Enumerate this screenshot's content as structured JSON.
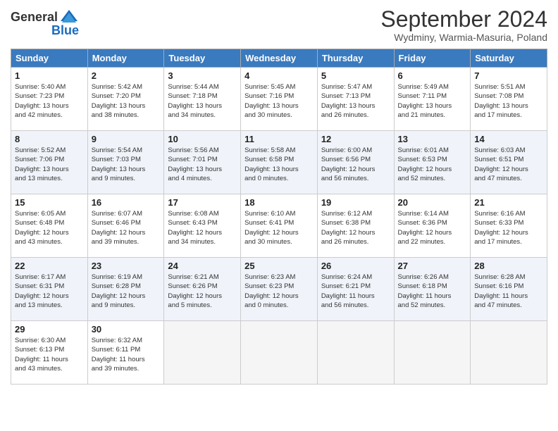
{
  "header": {
    "logo_general": "General",
    "logo_blue": "Blue",
    "month_title": "September 2024",
    "location": "Wydminy, Warmia-Masuria, Poland"
  },
  "days_of_week": [
    "Sunday",
    "Monday",
    "Tuesday",
    "Wednesday",
    "Thursday",
    "Friday",
    "Saturday"
  ],
  "weeks": [
    {
      "alt": false,
      "days": [
        {
          "num": "",
          "detail": ""
        },
        {
          "num": "2",
          "detail": "Sunrise: 5:42 AM\nSunset: 7:20 PM\nDaylight: 13 hours\nand 38 minutes."
        },
        {
          "num": "3",
          "detail": "Sunrise: 5:44 AM\nSunset: 7:18 PM\nDaylight: 13 hours\nand 34 minutes."
        },
        {
          "num": "4",
          "detail": "Sunrise: 5:45 AM\nSunset: 7:16 PM\nDaylight: 13 hours\nand 30 minutes."
        },
        {
          "num": "5",
          "detail": "Sunrise: 5:47 AM\nSunset: 7:13 PM\nDaylight: 13 hours\nand 26 minutes."
        },
        {
          "num": "6",
          "detail": "Sunrise: 5:49 AM\nSunset: 7:11 PM\nDaylight: 13 hours\nand 21 minutes."
        },
        {
          "num": "7",
          "detail": "Sunrise: 5:51 AM\nSunset: 7:08 PM\nDaylight: 13 hours\nand 17 minutes."
        }
      ],
      "first": {
        "num": "1",
        "detail": "Sunrise: 5:40 AM\nSunset: 7:23 PM\nDaylight: 13 hours\nand 42 minutes."
      }
    },
    {
      "alt": true,
      "days": [
        {
          "num": "8",
          "detail": "Sunrise: 5:52 AM\nSunset: 7:06 PM\nDaylight: 13 hours\nand 13 minutes."
        },
        {
          "num": "9",
          "detail": "Sunrise: 5:54 AM\nSunset: 7:03 PM\nDaylight: 13 hours\nand 9 minutes."
        },
        {
          "num": "10",
          "detail": "Sunrise: 5:56 AM\nSunset: 7:01 PM\nDaylight: 13 hours\nand 4 minutes."
        },
        {
          "num": "11",
          "detail": "Sunrise: 5:58 AM\nSunset: 6:58 PM\nDaylight: 13 hours\nand 0 minutes."
        },
        {
          "num": "12",
          "detail": "Sunrise: 6:00 AM\nSunset: 6:56 PM\nDaylight: 12 hours\nand 56 minutes."
        },
        {
          "num": "13",
          "detail": "Sunrise: 6:01 AM\nSunset: 6:53 PM\nDaylight: 12 hours\nand 52 minutes."
        },
        {
          "num": "14",
          "detail": "Sunrise: 6:03 AM\nSunset: 6:51 PM\nDaylight: 12 hours\nand 47 minutes."
        }
      ]
    },
    {
      "alt": false,
      "days": [
        {
          "num": "15",
          "detail": "Sunrise: 6:05 AM\nSunset: 6:48 PM\nDaylight: 12 hours\nand 43 minutes."
        },
        {
          "num": "16",
          "detail": "Sunrise: 6:07 AM\nSunset: 6:46 PM\nDaylight: 12 hours\nand 39 minutes."
        },
        {
          "num": "17",
          "detail": "Sunrise: 6:08 AM\nSunset: 6:43 PM\nDaylight: 12 hours\nand 34 minutes."
        },
        {
          "num": "18",
          "detail": "Sunrise: 6:10 AM\nSunset: 6:41 PM\nDaylight: 12 hours\nand 30 minutes."
        },
        {
          "num": "19",
          "detail": "Sunrise: 6:12 AM\nSunset: 6:38 PM\nDaylight: 12 hours\nand 26 minutes."
        },
        {
          "num": "20",
          "detail": "Sunrise: 6:14 AM\nSunset: 6:36 PM\nDaylight: 12 hours\nand 22 minutes."
        },
        {
          "num": "21",
          "detail": "Sunrise: 6:16 AM\nSunset: 6:33 PM\nDaylight: 12 hours\nand 17 minutes."
        }
      ]
    },
    {
      "alt": true,
      "days": [
        {
          "num": "22",
          "detail": "Sunrise: 6:17 AM\nSunset: 6:31 PM\nDaylight: 12 hours\nand 13 minutes."
        },
        {
          "num": "23",
          "detail": "Sunrise: 6:19 AM\nSunset: 6:28 PM\nDaylight: 12 hours\nand 9 minutes."
        },
        {
          "num": "24",
          "detail": "Sunrise: 6:21 AM\nSunset: 6:26 PM\nDaylight: 12 hours\nand 5 minutes."
        },
        {
          "num": "25",
          "detail": "Sunrise: 6:23 AM\nSunset: 6:23 PM\nDaylight: 12 hours\nand 0 minutes."
        },
        {
          "num": "26",
          "detail": "Sunrise: 6:24 AM\nSunset: 6:21 PM\nDaylight: 11 hours\nand 56 minutes."
        },
        {
          "num": "27",
          "detail": "Sunrise: 6:26 AM\nSunset: 6:18 PM\nDaylight: 11 hours\nand 52 minutes."
        },
        {
          "num": "28",
          "detail": "Sunrise: 6:28 AM\nSunset: 6:16 PM\nDaylight: 11 hours\nand 47 minutes."
        }
      ]
    },
    {
      "alt": false,
      "days": [
        {
          "num": "29",
          "detail": "Sunrise: 6:30 AM\nSunset: 6:13 PM\nDaylight: 11 hours\nand 43 minutes."
        },
        {
          "num": "30",
          "detail": "Sunrise: 6:32 AM\nSunset: 6:11 PM\nDaylight: 11 hours\nand 39 minutes."
        },
        {
          "num": "",
          "detail": ""
        },
        {
          "num": "",
          "detail": ""
        },
        {
          "num": "",
          "detail": ""
        },
        {
          "num": "",
          "detail": ""
        },
        {
          "num": "",
          "detail": ""
        }
      ]
    }
  ]
}
